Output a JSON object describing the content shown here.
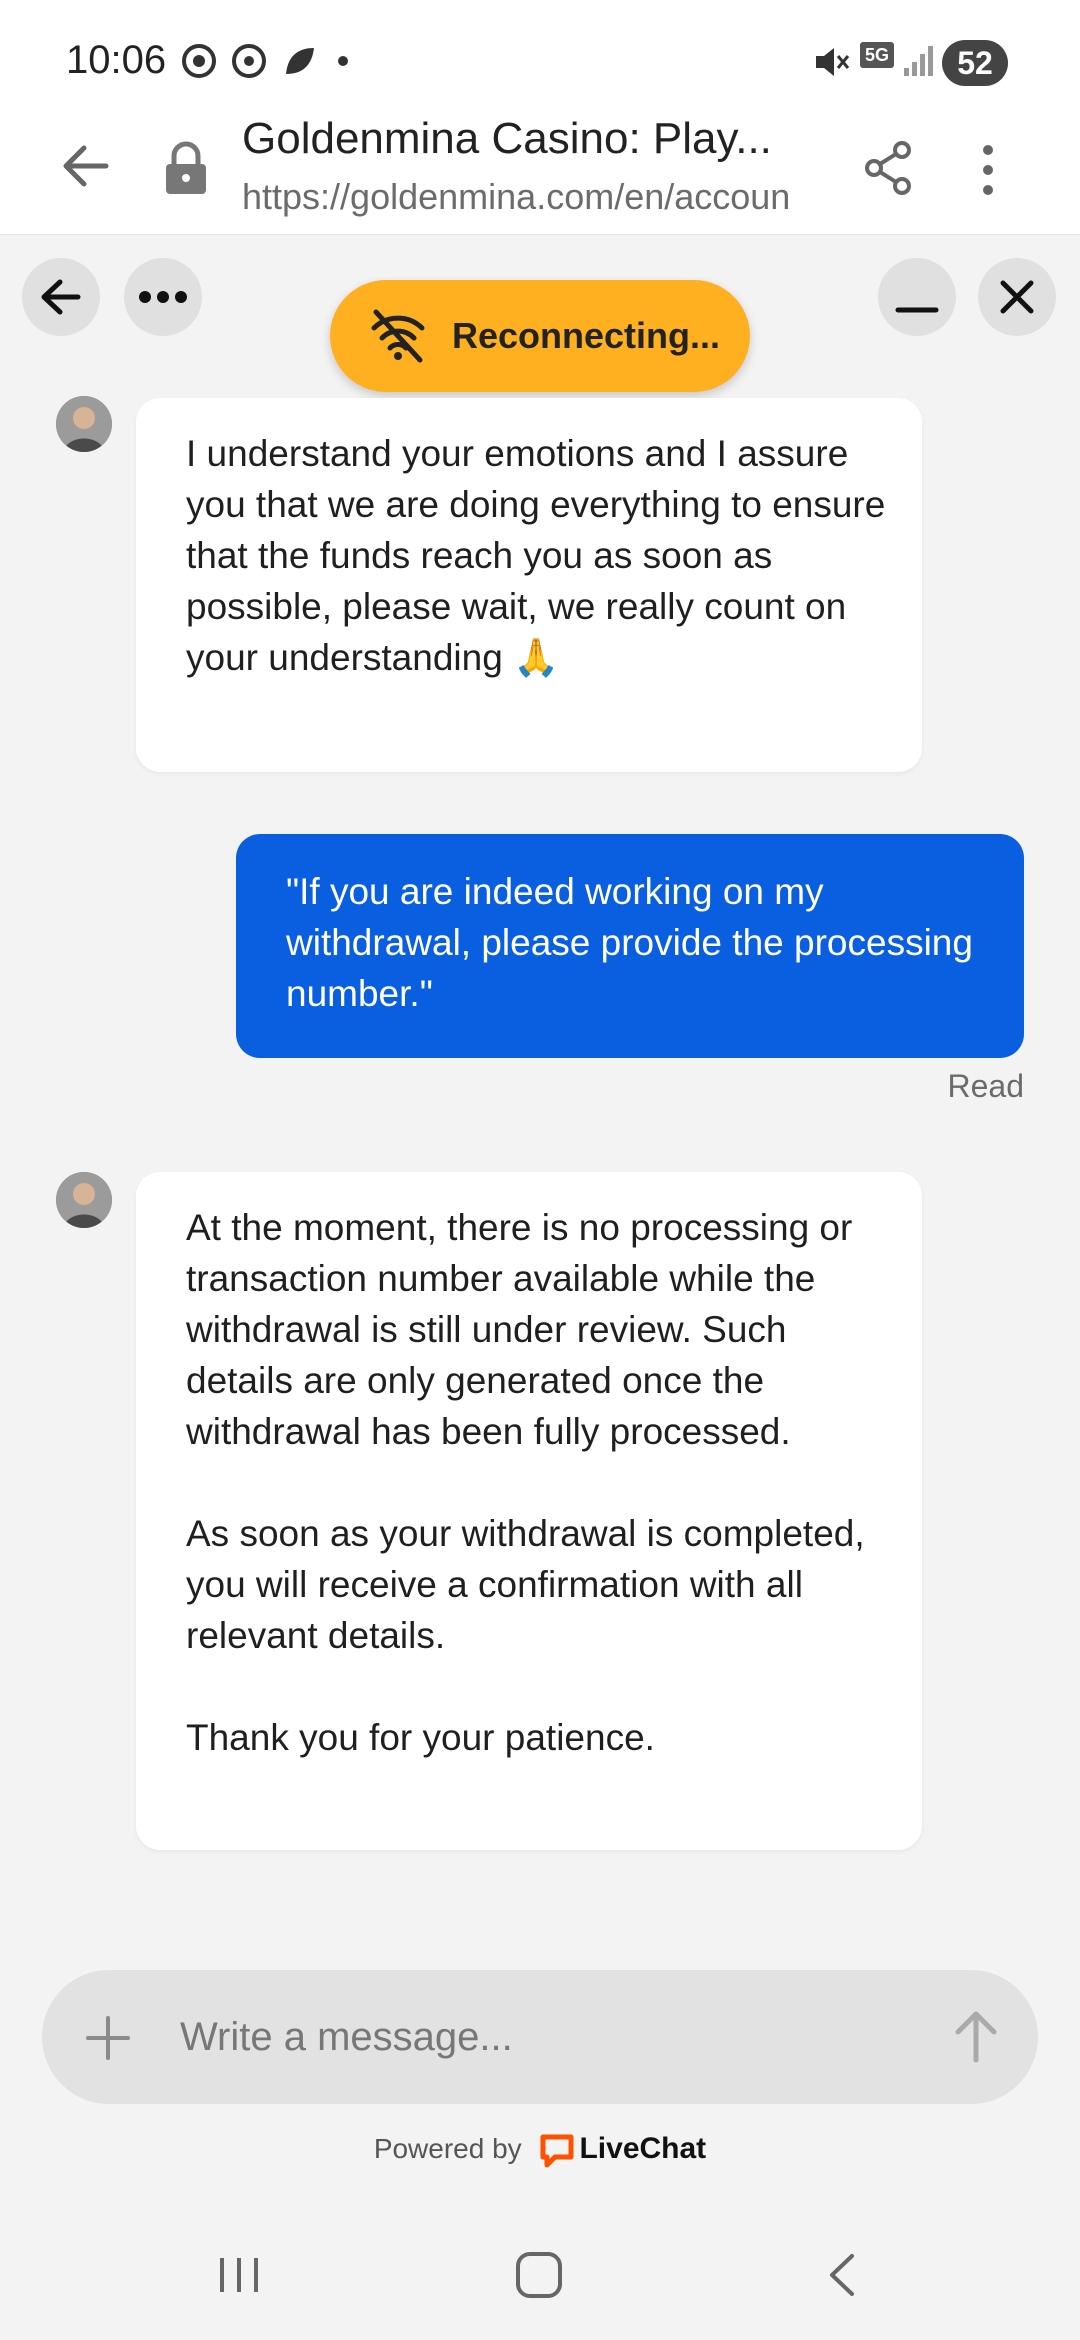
{
  "status_bar": {
    "time": "10:06",
    "battery": "52",
    "network": "5G"
  },
  "browser": {
    "title": "Goldenmina Casino: Play...",
    "url": "https://goldenmina.com/en/accoun"
  },
  "chat": {
    "reconnecting_label": "Reconnecting...",
    "messages": [
      {
        "from": "agent",
        "paragraphs": [
          "I understand your emotions and I assure you that we are doing everything to ensure that the funds reach you as soon as possible, please wait, we really count on your understanding 🙏"
        ]
      },
      {
        "from": "user",
        "paragraphs": [
          "\"If you are indeed working on my withdrawal, please provide the processing number.\""
        ],
        "status": "Read"
      },
      {
        "from": "agent",
        "paragraphs": [
          "At the moment, there is no processing or transaction number available while the withdrawal is still under review. Such details are only generated once the withdrawal has been fully processed.",
          "As soon as your withdrawal is completed, you will receive a confirmation with all relevant details.",
          "Thank you for your patience."
        ]
      }
    ]
  },
  "composer": {
    "placeholder": "Write a message..."
  },
  "footer": {
    "powered_by": "Powered by",
    "brand": "LiveChat"
  },
  "colors": {
    "accent_blue": "#0a5fe0",
    "reconnect_banner": "#ffb020",
    "livechat_orange": "#ff5100"
  },
  "icons": [
    "back-arrow-icon",
    "lock-icon",
    "share-icon",
    "more-vert-icon",
    "ellipsis-icon",
    "minimize-icon",
    "close-icon",
    "wifi-off-icon",
    "plus-icon",
    "send-arrow-icon"
  ]
}
